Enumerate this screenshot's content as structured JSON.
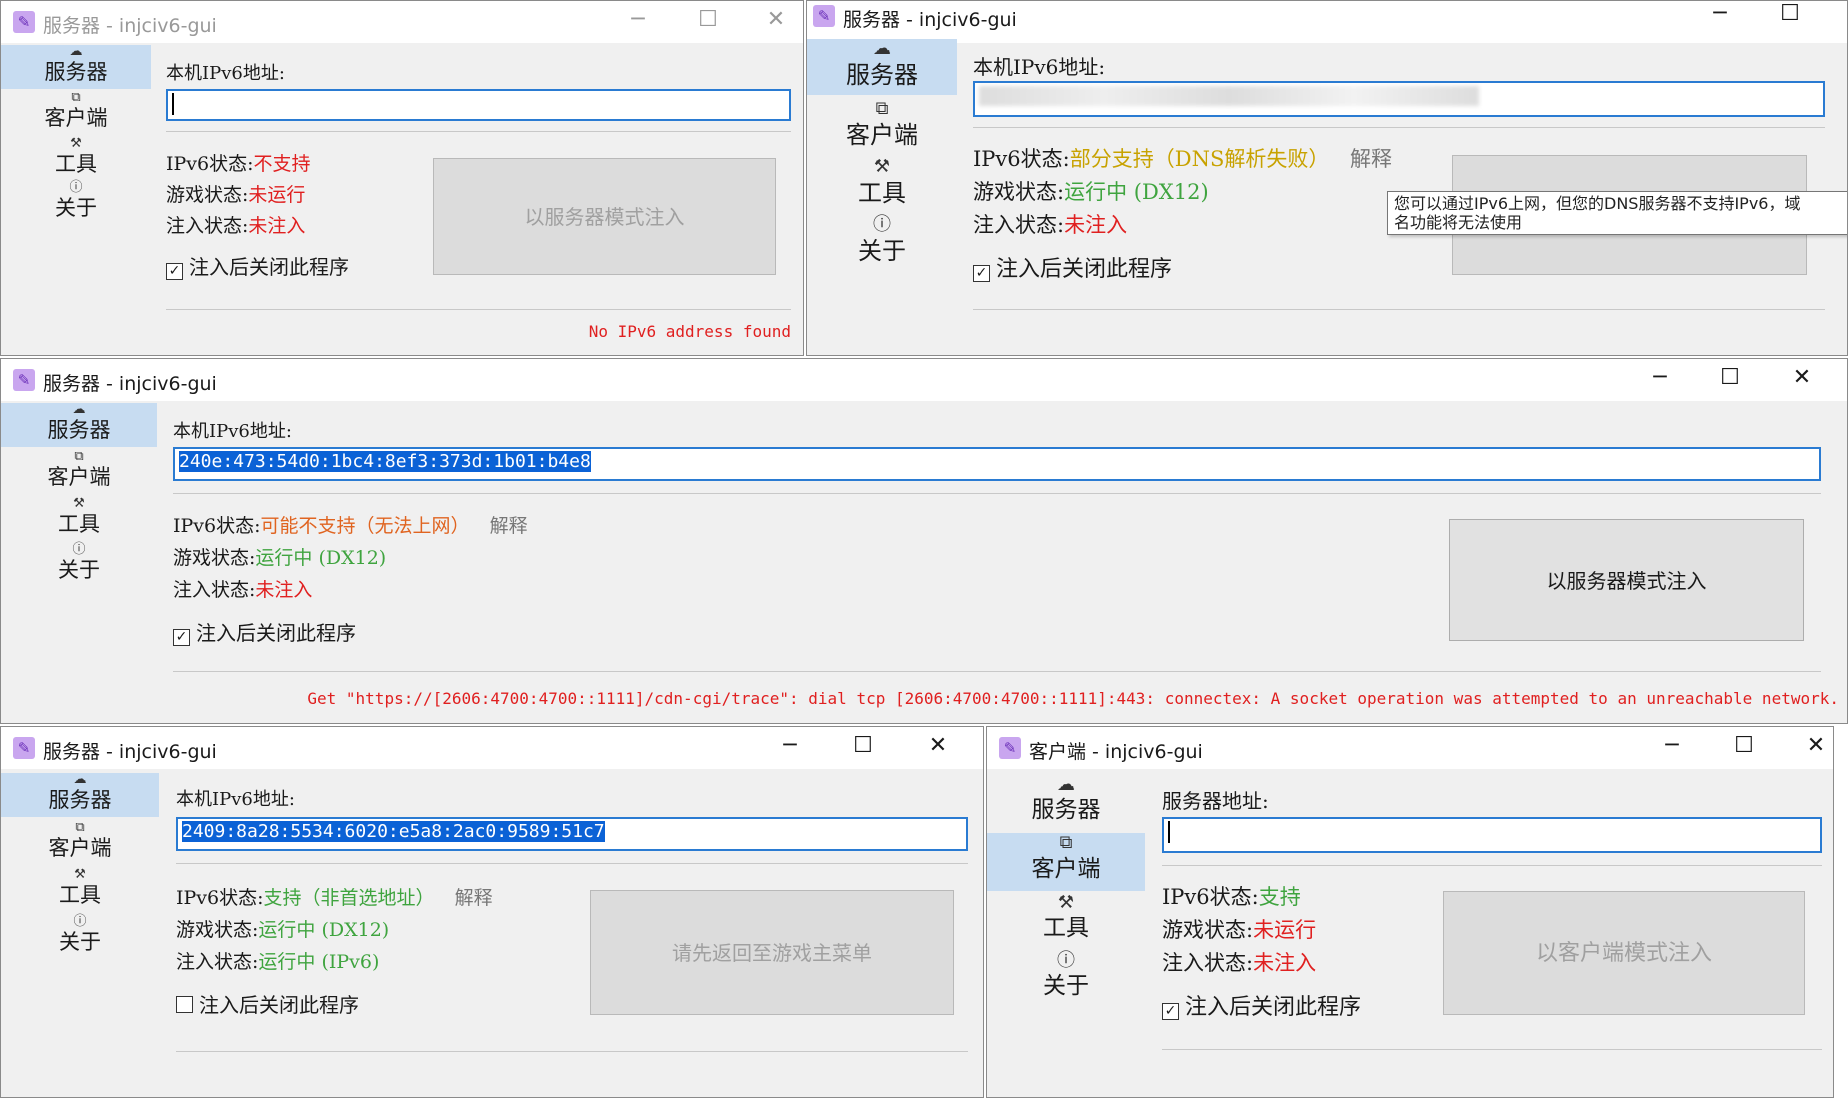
{
  "common": {
    "nav_server": "服务器",
    "nav_client": "客户端",
    "nav_tools": "工具",
    "nav_about": "关于",
    "ipv6_addr_label": "本机IPv6地址:",
    "server_addr_label": "服务器地址:",
    "ipv6_status_label": "IPv6状态:",
    "game_status_label": "游戏状态:",
    "inject_status_label": "注入状态:",
    "close_after_inject": "注入后关闭此程序",
    "explain": "解释",
    "minimize": "─",
    "maximize": "☐",
    "close": "✕"
  },
  "colors": {
    "error": "#e02020",
    "ok": "#3fa43f",
    "warning": "#c8a200",
    "caution": "#e06420",
    "selection": "#0b62d6",
    "nav_active": "#c7dcf1"
  },
  "windows": [
    {
      "title": "服务器 - injciv6-gui",
      "state": "inactive",
      "active_nav": "server",
      "ipv6_address": "",
      "ipv6_status": "不支持",
      "game_status": "未运行",
      "inject_status": "未注入",
      "button": "以服务器模式注入",
      "checkbox_checked": true,
      "message": "No IPv6 address found"
    },
    {
      "title": "服务器 - injciv6-gui",
      "state": "active",
      "active_nav": "server",
      "ipv6_address": "",
      "ipv6_status": "部分支持（DNS解析失败）",
      "game_status": "运行中 (DX12)",
      "inject_status": "未注入",
      "button": "",
      "checkbox_checked": true,
      "tooltip_line1": "您可以通过IPv6上网，但您的DNS服务器不支持IPv6，域",
      "tooltip_line2": "名功能将无法使用"
    },
    {
      "title": "服务器 - injciv6-gui",
      "state": "active",
      "active_nav": "server",
      "ipv6_address": "240e:473:54d0:1bc4:8ef3:373d:1b01:b4e8",
      "ipv6_status": "可能不支持（无法上网）",
      "game_status": "运行中 (DX12)",
      "inject_status": "未注入",
      "button": "以服务器模式注入",
      "checkbox_checked": true,
      "message": "Get \"https://[2606:4700:4700::1111]/cdn-cgi/trace\": dial tcp [2606:4700:4700::1111]:443: connectex: A socket operation was attempted to an unreachable network."
    },
    {
      "title": "服务器 - injciv6-gui",
      "state": "active",
      "active_nav": "server",
      "ipv6_address": "2409:8a28:5534:6020:e5a8:2ac0:9589:51c7",
      "ipv6_status": "支持（非首选地址）",
      "game_status": "运行中 (DX12)",
      "inject_status": "运行中 (IPv6)",
      "button": "请先返回至游戏主菜单",
      "checkbox_checked": false
    },
    {
      "title": "客户端 - injciv6-gui",
      "state": "active",
      "active_nav": "client",
      "server_address": "",
      "ipv6_status": "支持",
      "game_status": "未运行",
      "inject_status": "未注入",
      "button": "以客户端模式注入",
      "checkbox_checked": true
    }
  ]
}
